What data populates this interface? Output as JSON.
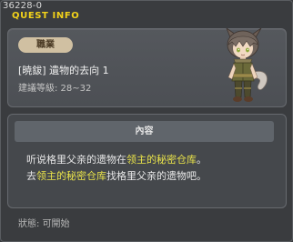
{
  "window": {
    "quest_id": "36228-0",
    "title": "QUEST INFO"
  },
  "quest": {
    "job_label": "職業",
    "name": "[暁鈸] 遺物的去向 1",
    "level_range": "建議等級: 28~32"
  },
  "content": {
    "header": "內容",
    "lines": [
      [
        {
          "text": "听说格里父亲的遗物在",
          "highlight": false
        },
        {
          "text": "领主的秘密仓库",
          "highlight": true
        },
        {
          "text": "。",
          "highlight": false
        }
      ],
      [
        {
          "text": "去",
          "highlight": false
        },
        {
          "text": "领主的秘密仓库",
          "highlight": true
        },
        {
          "text": "找格里父亲的遗物吧。",
          "highlight": false
        }
      ]
    ]
  },
  "status": {
    "text": "狀態:  可開始"
  },
  "colors": {
    "title": "#f2d21a",
    "highlight": "#e9e34a",
    "badge": "#d0c0a2"
  },
  "icons": {
    "character": "quest-npc-character-icon"
  }
}
